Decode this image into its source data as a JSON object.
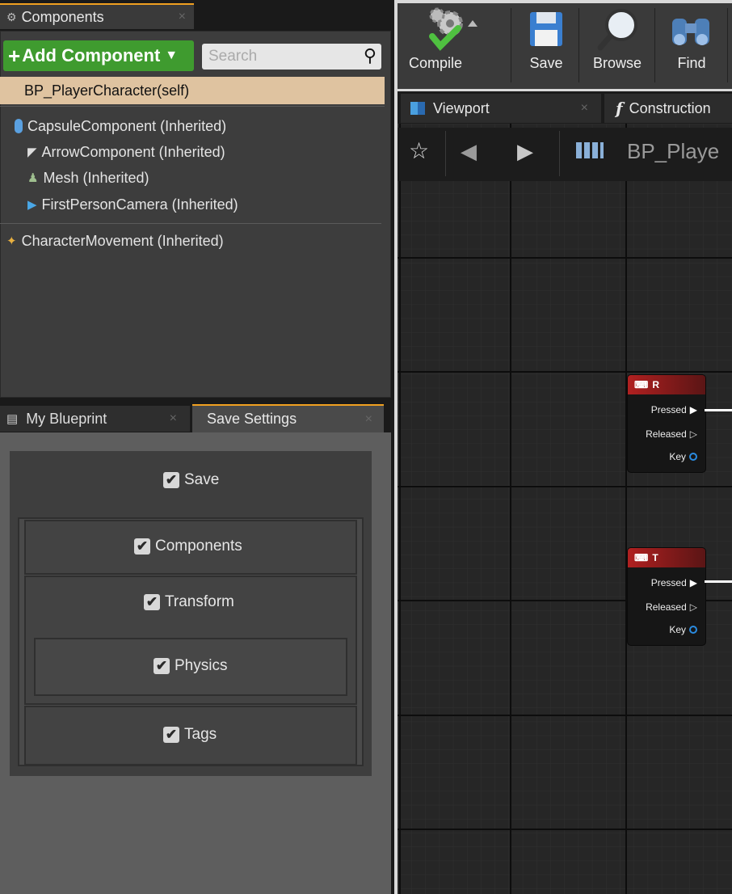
{
  "components_panel": {
    "tab_label": "Components",
    "tab_close": "×",
    "add_component_label": "Add Component",
    "search_placeholder": "Search",
    "self_item": "BP_PlayerCharacter(self)",
    "tree": [
      {
        "label": "CapsuleComponent (Inherited)",
        "icon": "capsule-icon"
      },
      {
        "label": "ArrowComponent (Inherited)",
        "icon": "arrow-icon"
      },
      {
        "label": "Mesh (Inherited)",
        "icon": "mesh-icon"
      },
      {
        "label": "FirstPersonCamera (Inherited)",
        "icon": "camera-icon"
      }
    ],
    "movement_item": "CharacterMovement (Inherited)"
  },
  "lower_tabs": {
    "my_blueprint": "My Blueprint",
    "save_settings": "Save Settings",
    "close": "×"
  },
  "save_settings": {
    "save": {
      "label": "Save",
      "checked": true
    },
    "components": {
      "label": "Components",
      "checked": true
    },
    "transform": {
      "label": "Transform",
      "checked": true
    },
    "physics": {
      "label": "Physics",
      "checked": true
    },
    "tags": {
      "label": "Tags",
      "checked": true
    }
  },
  "toolbar": {
    "compile": "Compile",
    "save": "Save",
    "browse": "Browse",
    "find": "Find"
  },
  "editor_tabs": {
    "viewport": "Viewport",
    "construction": "Construction",
    "close": "×"
  },
  "breadcrumb": {
    "title": "BP_Playe"
  },
  "graph_nodes": [
    {
      "key": "R",
      "pins": [
        "Pressed",
        "Released",
        "Key"
      ]
    },
    {
      "key": "T",
      "pins": [
        "Pressed",
        "Released",
        "Key"
      ]
    }
  ],
  "colors": {
    "accent_tab": "#f0a020",
    "add_button": "#3f9b2f",
    "selected_row": "#dfc3a0",
    "node_header": "#b02020",
    "key_pin": "#2a8be0"
  }
}
